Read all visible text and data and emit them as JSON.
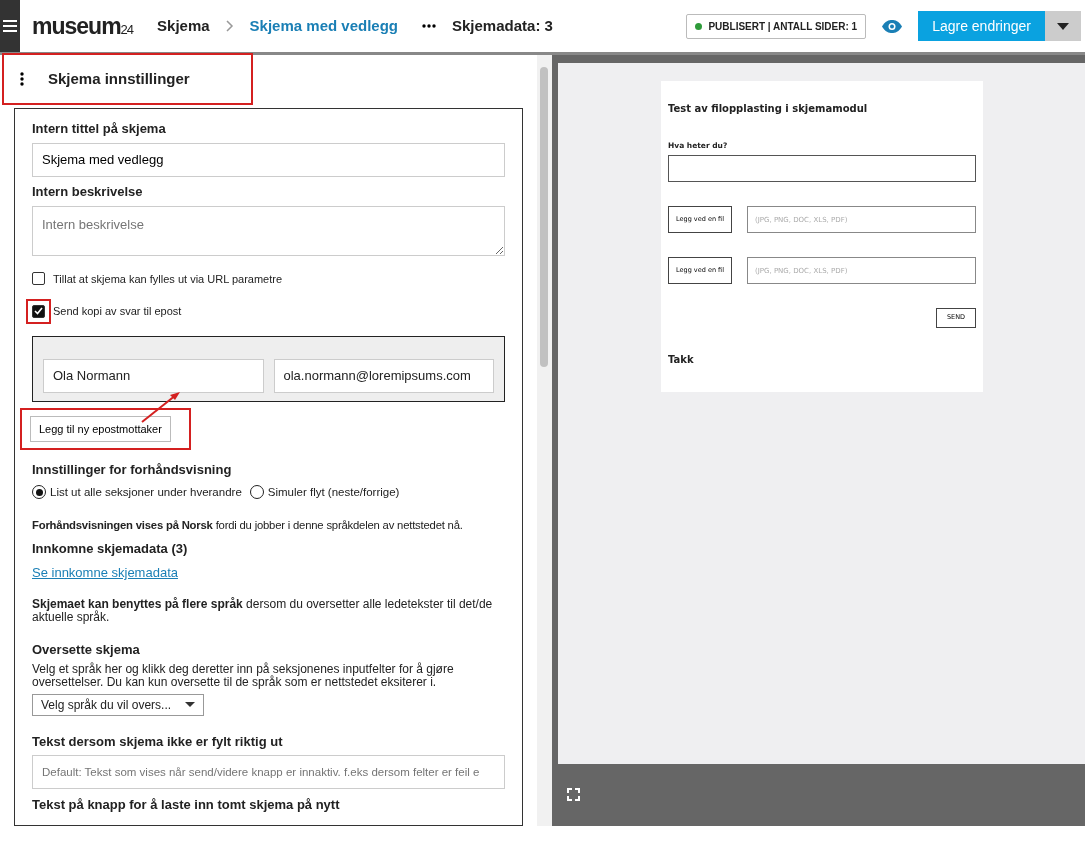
{
  "topbar": {
    "logo": "museum",
    "logo_suffix": "24",
    "breadcrumbs": [
      {
        "label": "Skjema",
        "current": false
      },
      {
        "label": "Skjema med vedlegg",
        "current": true
      }
    ],
    "data_count": "Skjemadata: 3",
    "status": {
      "text": "PUBLISERT | ANTALL SIDER: 1",
      "color": "#2e9b3a"
    },
    "save_button": "Lagre endringer"
  },
  "settings": {
    "title": "Skjema innstillinger",
    "highlighted": true,
    "internal_title": {
      "label": "Intern tittel på skjema",
      "value": "Skjema med vedlegg"
    },
    "internal_description": {
      "label": "Intern beskrivelse",
      "placeholder": "Intern beskrivelse"
    },
    "checkboxes": [
      {
        "label": "Tillat at skjema kan fylles ut via URL parametre",
        "checked": false,
        "highlighted": false
      },
      {
        "label": "Send kopi av svar til epost",
        "checked": true,
        "highlighted": true
      }
    ],
    "recipients": [
      {
        "name": "Ola Normann",
        "email": "ola.normann@loremipsums.com"
      }
    ],
    "add_recipient": {
      "label": "Legg til ny epostmottaker",
      "highlighted": true
    },
    "preview_heading": "Innstillinger for forhåndsvisning",
    "preview_options": [
      {
        "label": "List ut alle seksjoner under hverandre",
        "selected": true
      },
      {
        "label": "Simuler flyt (neste/forrige)",
        "selected": false
      }
    ],
    "language_note": "**Forhåndsvisningen vises på Norsk** fordi du jobber i denne språkdelen av nettstedet nå.",
    "incoming_heading": "Innkomne skjemadata (3)",
    "incoming_link": "Se innkomne skjemadata",
    "multilang_note": "**Skjemaet kan benyttes på flere språk** dersom du oversetter alle ledetekster til det/de aktuelle språk.",
    "translate_heading": "Oversette skjema",
    "translate_help": "Velg et språk her og klikk deg deretter inn på seksjonenes inputfelter for å gjøre oversettelser. Du kan kun oversette til de språk som er nettstedet eksiterer i.",
    "language_select": "Velg språk du vil overs...",
    "invalid_text": {
      "label": "Tekst dersom skjema ikke er fylt riktig ut",
      "placeholder": "Default: Tekst som vises når send/videre knapp er innaktiv. f.eks dersom felter er feil e"
    },
    "reload_label": "Tekst på knapp for å laste inn tomt skjema på nytt"
  },
  "preview": {
    "title": "Test av filopplasting i skjemamodul",
    "name_label": "Hva heter du?",
    "files": [
      {
        "button": "Legg ved en fil",
        "placeholder": "(JPG, PNG, DOC, XLS, PDF)"
      },
      {
        "button": "Legg ved en fil",
        "placeholder": "(JPG, PNG, DOC, XLS, PDF)"
      }
    ],
    "send": "SEND",
    "thanks": "Takk"
  }
}
